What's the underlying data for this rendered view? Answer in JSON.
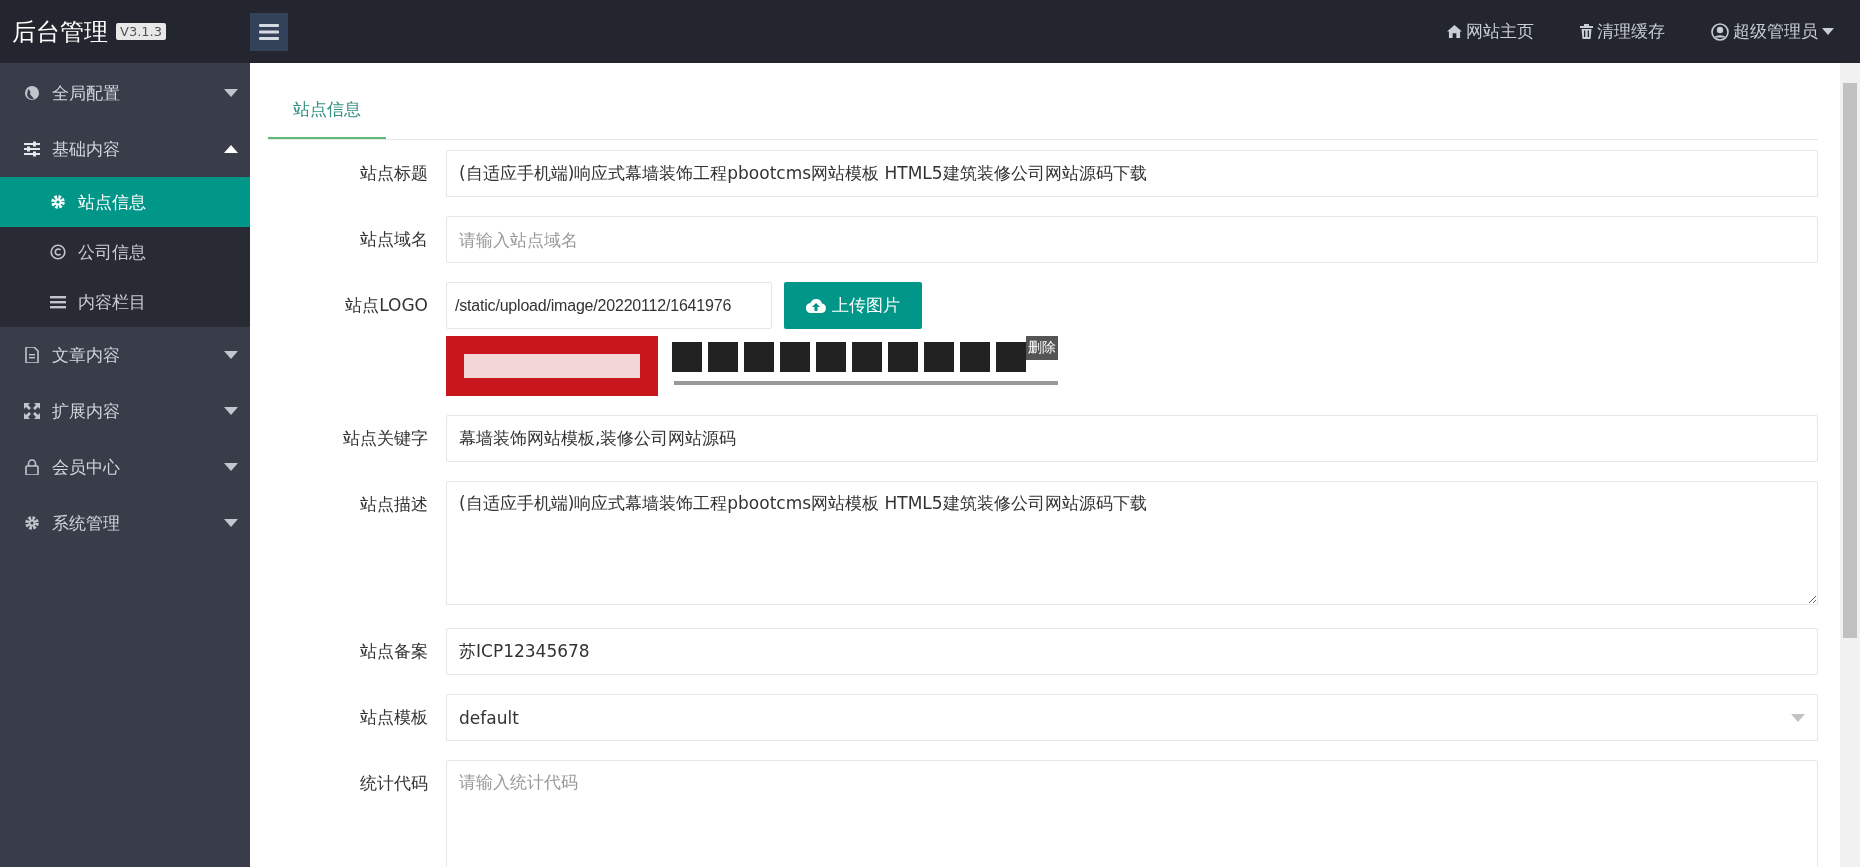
{
  "header": {
    "title": "后台管理",
    "version": "V3.1.3",
    "links": [
      {
        "kind": "home",
        "label": "网站主页"
      },
      {
        "kind": "trash",
        "label": "清理缓存"
      },
      {
        "kind": "user",
        "label": "超级管理员"
      }
    ]
  },
  "sidebar": {
    "items": [
      {
        "kind": "globe",
        "label": "全局配置",
        "expanded": false
      },
      {
        "kind": "sliders",
        "label": "基础内容",
        "expanded": true,
        "children": [
          {
            "kind": "gear",
            "label": "站点信息",
            "selected": true
          },
          {
            "kind": "copyright",
            "label": "公司信息",
            "selected": false
          },
          {
            "kind": "list",
            "label": "内容栏目",
            "selected": false
          }
        ]
      },
      {
        "kind": "file",
        "label": "文章内容",
        "expanded": false
      },
      {
        "kind": "expand",
        "label": "扩展内容",
        "expanded": false
      },
      {
        "kind": "lock",
        "label": "会员中心",
        "expanded": false
      },
      {
        "kind": "cog",
        "label": "系统管理",
        "expanded": false
      }
    ]
  },
  "tabs": [
    {
      "label": "站点信息",
      "selected": true
    }
  ],
  "form": [
    {
      "kind": "text",
      "label": "站点标题",
      "value": "(自适应手机端)响应式幕墙装饰工程pbootcms网站模板 HTML5建筑装修公司网站源码下载"
    },
    {
      "kind": "text",
      "label": "站点域名",
      "placeholder": "请输入站点域名"
    },
    {
      "kind": "upload",
      "label": "站点LOGO",
      "value": "/static/upload/image/20220112/1641976",
      "button": "上传图片",
      "delete": "删除"
    },
    {
      "kind": "text",
      "label": "站点关键字",
      "value": "幕墙装饰网站模板,装修公司网站源码"
    },
    {
      "kind": "textarea",
      "label": "站点描述",
      "value": "(自适应手机端)响应式幕墙装饰工程pbootcms网站模板 HTML5建筑装修公司网站源码下载"
    },
    {
      "kind": "text",
      "label": "站点备案",
      "value": "苏ICP12345678"
    },
    {
      "kind": "select",
      "label": "站点模板",
      "value": "default"
    },
    {
      "kind": "textarea",
      "label": "统计代码",
      "placeholder": "请输入统计代码"
    }
  ]
}
